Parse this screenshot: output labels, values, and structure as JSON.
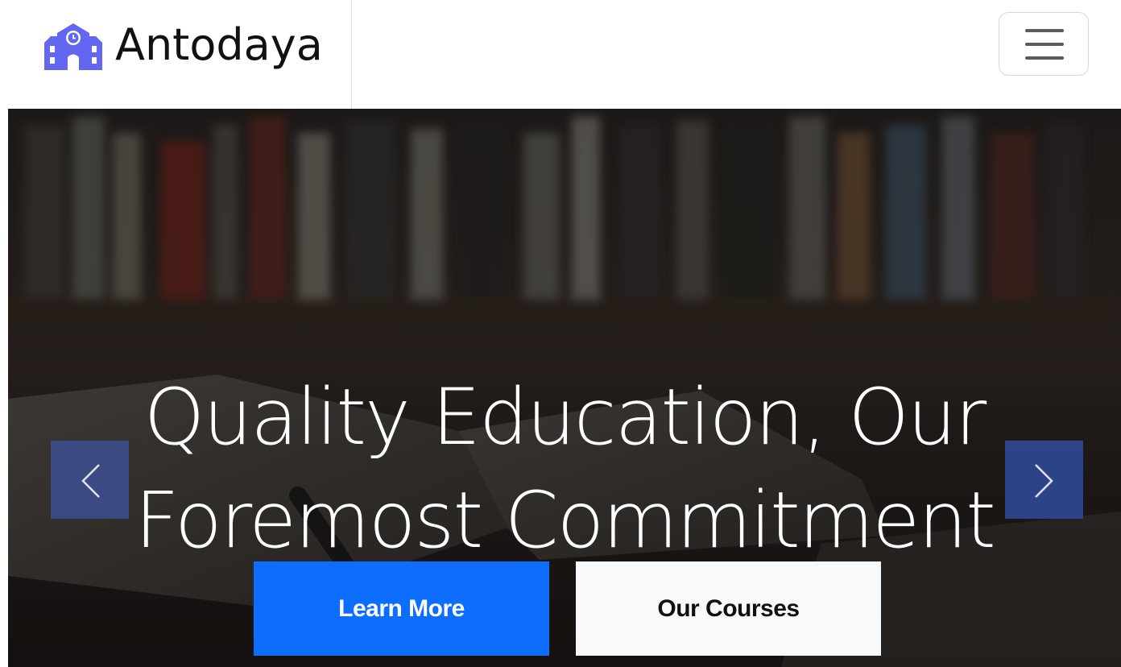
{
  "navbar": {
    "brand_name": "Antodaya",
    "brand_color": "#6366f1",
    "brand_icon": "school-icon",
    "toggle_icon": "hamburger-menu-icon"
  },
  "hero": {
    "headline_line1": "Quality Education, Our",
    "headline_line2": "Foremost Commitment",
    "prev_icon": "chevron-left-icon",
    "next_icon": "chevron-right-icon",
    "primary_button": "Learn More",
    "secondary_button": "Our Courses",
    "primary_color": "#0d6efd",
    "arrow_color": "#3f54a0"
  }
}
